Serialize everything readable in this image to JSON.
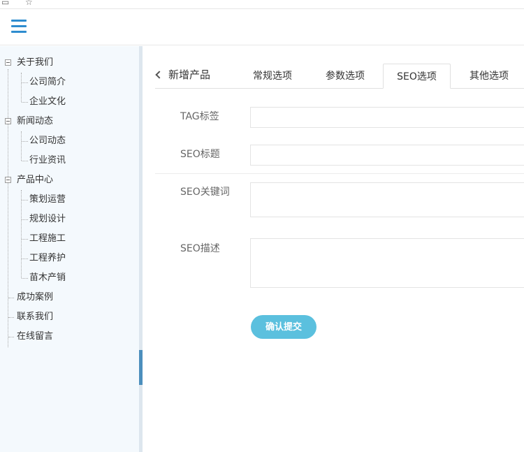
{
  "header": {
    "menu_icon": "hamburger-menu-icon"
  },
  "sidebar": {
    "tree": [
      {
        "label": "关于我们",
        "children": [
          "公司简介",
          "企业文化"
        ]
      },
      {
        "label": "新闻动态",
        "children": [
          "公司动态",
          "行业资讯"
        ]
      },
      {
        "label": "产品中心",
        "children": [
          "策划运营",
          "规划设计",
          "工程施工",
          "工程养护",
          "苗木产销"
        ]
      },
      {
        "label": "成功案例",
        "children": []
      },
      {
        "label": "联系我们",
        "children": []
      },
      {
        "label": "在线留言",
        "children": []
      }
    ]
  },
  "main": {
    "title": "新增产品",
    "tabs": [
      {
        "label": "常规选项",
        "active": false
      },
      {
        "label": "参数选项",
        "active": false
      },
      {
        "label": "SEO选项",
        "active": true
      },
      {
        "label": "其他选项",
        "active": false
      }
    ],
    "form": {
      "tag_label": "TAG标签",
      "seo_title_label": "SEO标题",
      "seo_keywords_label": "SEO关键词",
      "seo_description_label": "SEO描述",
      "submit_label": "确认提交"
    }
  },
  "colors": {
    "accent": "#2e8ccf",
    "submit": "#5bc0de",
    "sidebar_bg": "#f4f9fd",
    "scroll_thumb": "#4c8fbd"
  }
}
